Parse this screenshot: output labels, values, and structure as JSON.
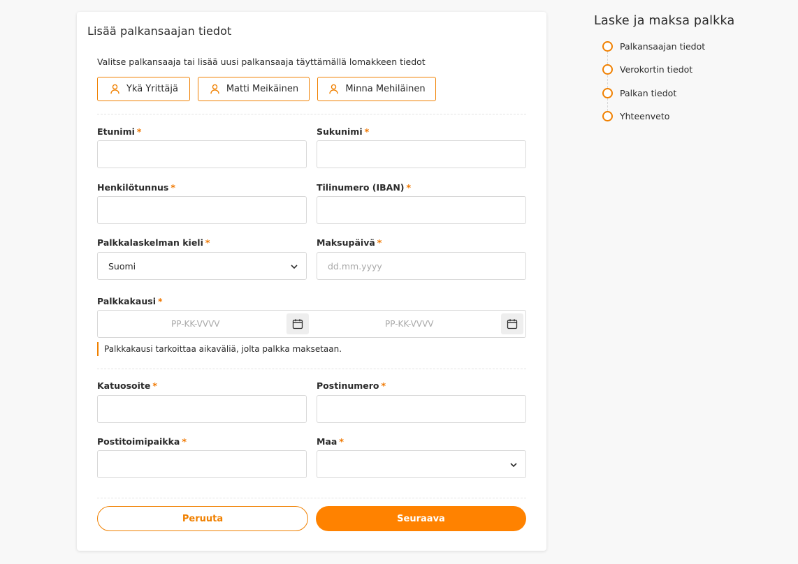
{
  "form": {
    "title": "Lisää palkansaajan tiedot",
    "intro": "Valitse palkansaaja tai lisää uusi palkansaaja täyttämällä lomakkeen tiedot",
    "payees": [
      {
        "label": "Ykä Yrittäjä",
        "icon": "user-icon"
      },
      {
        "label": "Matti Meikäinen",
        "icon": "user-icon"
      },
      {
        "label": "Minna Mehiläinen",
        "icon": "user-icon"
      }
    ],
    "required_mark": "*",
    "fields": {
      "first_name": {
        "label": "Etunimi",
        "value": ""
      },
      "last_name": {
        "label": "Sukunimi",
        "value": ""
      },
      "ssn": {
        "label": "Henkilötunnus",
        "value": ""
      },
      "iban": {
        "label": "Tilinumero (IBAN)",
        "value": ""
      },
      "language": {
        "label": "Palkkalaskelman kieli",
        "value": "Suomi"
      },
      "payment_date": {
        "label": "Maksupäivä",
        "placeholder": "dd.mm.yyyy"
      },
      "pay_period": {
        "label": "Palkkakausi",
        "start_placeholder": "PP-KK-VVVV",
        "end_placeholder": "PP-KK-VVVV",
        "hint": "Palkkakausi tarkoittaa aikaväliä, jolta palkka maksetaan."
      },
      "street": {
        "label": "Katuosoite",
        "value": ""
      },
      "postal_code": {
        "label": "Postinumero",
        "value": ""
      },
      "city": {
        "label": "Postitoimipaikka",
        "value": ""
      },
      "country": {
        "label": "Maa",
        "value": ""
      }
    },
    "buttons": {
      "cancel": "Peruuta",
      "next": "Seuraava"
    }
  },
  "steps": {
    "title": "Laske ja maksa palkka",
    "items": [
      {
        "label": "Palkansaajan tiedot"
      },
      {
        "label": "Verokortin tiedot"
      },
      {
        "label": "Palkan tiedot"
      },
      {
        "label": "Yhteenveto"
      }
    ]
  },
  "colors": {
    "accent": "#ff8200",
    "border": "#d8d8d8",
    "background": "#f8f8f8"
  }
}
